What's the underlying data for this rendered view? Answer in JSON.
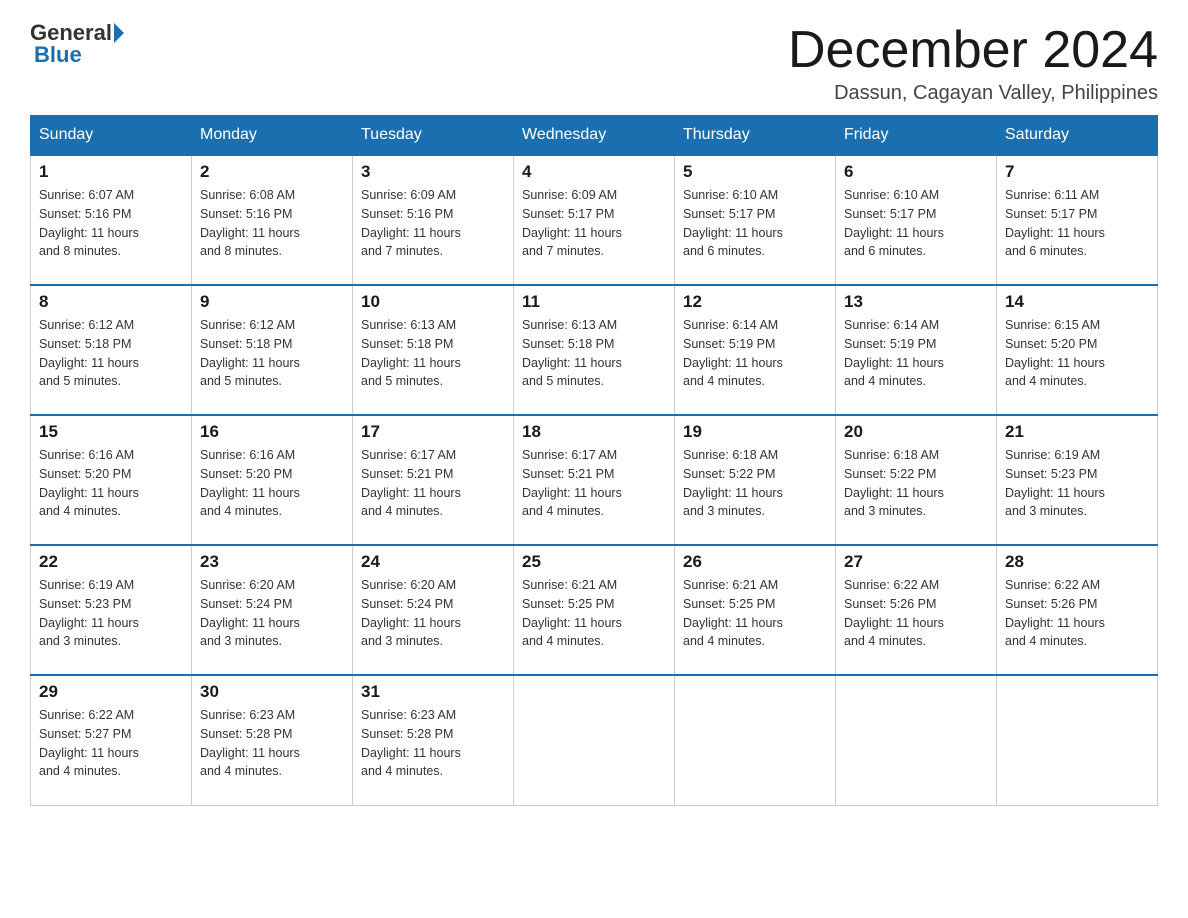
{
  "header": {
    "logo_general": "General",
    "logo_blue": "Blue",
    "title": "December 2024",
    "subtitle": "Dassun, Cagayan Valley, Philippines"
  },
  "weekdays": [
    "Sunday",
    "Monday",
    "Tuesday",
    "Wednesday",
    "Thursday",
    "Friday",
    "Saturday"
  ],
  "weeks": [
    [
      {
        "day": "1",
        "sunrise": "6:07 AM",
        "sunset": "5:16 PM",
        "daylight": "11 hours and 8 minutes."
      },
      {
        "day": "2",
        "sunrise": "6:08 AM",
        "sunset": "5:16 PM",
        "daylight": "11 hours and 8 minutes."
      },
      {
        "day": "3",
        "sunrise": "6:09 AM",
        "sunset": "5:16 PM",
        "daylight": "11 hours and 7 minutes."
      },
      {
        "day": "4",
        "sunrise": "6:09 AM",
        "sunset": "5:17 PM",
        "daylight": "11 hours and 7 minutes."
      },
      {
        "day": "5",
        "sunrise": "6:10 AM",
        "sunset": "5:17 PM",
        "daylight": "11 hours and 6 minutes."
      },
      {
        "day": "6",
        "sunrise": "6:10 AM",
        "sunset": "5:17 PM",
        "daylight": "11 hours and 6 minutes."
      },
      {
        "day": "7",
        "sunrise": "6:11 AM",
        "sunset": "5:17 PM",
        "daylight": "11 hours and 6 minutes."
      }
    ],
    [
      {
        "day": "8",
        "sunrise": "6:12 AM",
        "sunset": "5:18 PM",
        "daylight": "11 hours and 5 minutes."
      },
      {
        "day": "9",
        "sunrise": "6:12 AM",
        "sunset": "5:18 PM",
        "daylight": "11 hours and 5 minutes."
      },
      {
        "day": "10",
        "sunrise": "6:13 AM",
        "sunset": "5:18 PM",
        "daylight": "11 hours and 5 minutes."
      },
      {
        "day": "11",
        "sunrise": "6:13 AM",
        "sunset": "5:18 PM",
        "daylight": "11 hours and 5 minutes."
      },
      {
        "day": "12",
        "sunrise": "6:14 AM",
        "sunset": "5:19 PM",
        "daylight": "11 hours and 4 minutes."
      },
      {
        "day": "13",
        "sunrise": "6:14 AM",
        "sunset": "5:19 PM",
        "daylight": "11 hours and 4 minutes."
      },
      {
        "day": "14",
        "sunrise": "6:15 AM",
        "sunset": "5:20 PM",
        "daylight": "11 hours and 4 minutes."
      }
    ],
    [
      {
        "day": "15",
        "sunrise": "6:16 AM",
        "sunset": "5:20 PM",
        "daylight": "11 hours and 4 minutes."
      },
      {
        "day": "16",
        "sunrise": "6:16 AM",
        "sunset": "5:20 PM",
        "daylight": "11 hours and 4 minutes."
      },
      {
        "day": "17",
        "sunrise": "6:17 AM",
        "sunset": "5:21 PM",
        "daylight": "11 hours and 4 minutes."
      },
      {
        "day": "18",
        "sunrise": "6:17 AM",
        "sunset": "5:21 PM",
        "daylight": "11 hours and 4 minutes."
      },
      {
        "day": "19",
        "sunrise": "6:18 AM",
        "sunset": "5:22 PM",
        "daylight": "11 hours and 3 minutes."
      },
      {
        "day": "20",
        "sunrise": "6:18 AM",
        "sunset": "5:22 PM",
        "daylight": "11 hours and 3 minutes."
      },
      {
        "day": "21",
        "sunrise": "6:19 AM",
        "sunset": "5:23 PM",
        "daylight": "11 hours and 3 minutes."
      }
    ],
    [
      {
        "day": "22",
        "sunrise": "6:19 AM",
        "sunset": "5:23 PM",
        "daylight": "11 hours and 3 minutes."
      },
      {
        "day": "23",
        "sunrise": "6:20 AM",
        "sunset": "5:24 PM",
        "daylight": "11 hours and 3 minutes."
      },
      {
        "day": "24",
        "sunrise": "6:20 AM",
        "sunset": "5:24 PM",
        "daylight": "11 hours and 3 minutes."
      },
      {
        "day": "25",
        "sunrise": "6:21 AM",
        "sunset": "5:25 PM",
        "daylight": "11 hours and 4 minutes."
      },
      {
        "day": "26",
        "sunrise": "6:21 AM",
        "sunset": "5:25 PM",
        "daylight": "11 hours and 4 minutes."
      },
      {
        "day": "27",
        "sunrise": "6:22 AM",
        "sunset": "5:26 PM",
        "daylight": "11 hours and 4 minutes."
      },
      {
        "day": "28",
        "sunrise": "6:22 AM",
        "sunset": "5:26 PM",
        "daylight": "11 hours and 4 minutes."
      }
    ],
    [
      {
        "day": "29",
        "sunrise": "6:22 AM",
        "sunset": "5:27 PM",
        "daylight": "11 hours and 4 minutes."
      },
      {
        "day": "30",
        "sunrise": "6:23 AM",
        "sunset": "5:28 PM",
        "daylight": "11 hours and 4 minutes."
      },
      {
        "day": "31",
        "sunrise": "6:23 AM",
        "sunset": "5:28 PM",
        "daylight": "11 hours and 4 minutes."
      },
      null,
      null,
      null,
      null
    ]
  ],
  "labels": {
    "sunrise": "Sunrise:",
    "sunset": "Sunset:",
    "daylight": "Daylight:"
  }
}
